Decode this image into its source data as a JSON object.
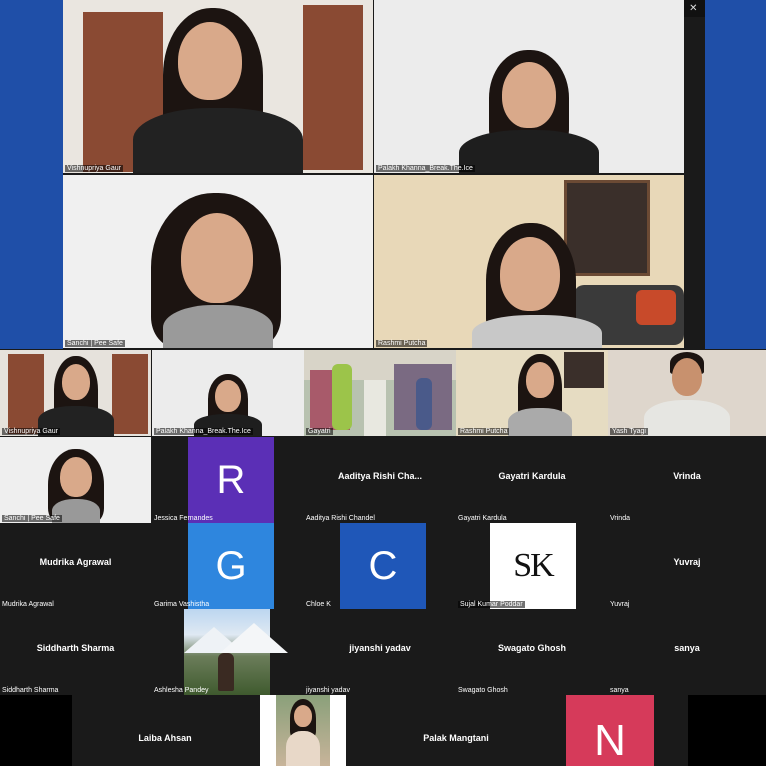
{
  "window": {
    "controls": [
      "–",
      "❐",
      "✕"
    ]
  },
  "speaker_view": [
    {
      "name": "Vishnupriya Gaur"
    },
    {
      "name": "Palakh Khanna_Break.The.Ice"
    },
    {
      "name": "Sanchi | Pee Safe"
    },
    {
      "name": "Rashmi Putcha"
    }
  ],
  "gallery": {
    "video_tiles": [
      {
        "label": "Vishnupriya Gaur"
      },
      {
        "label": "Palakh Khanna_Break.The.Ice"
      },
      {
        "label": "Gayatri"
      },
      {
        "label": "Rashmi Putcha"
      },
      {
        "label": "Yash Tyagi"
      },
      {
        "label": "Sanchi | Pee Safe"
      }
    ],
    "participants": {
      "jessica": {
        "label": "Jessica Fernandes",
        "avatar": "R",
        "color": "#5b2fb6"
      },
      "aaditya": {
        "name": "Aaditya Rishi Cha...",
        "label": "Aaditya Rishi Chandel"
      },
      "gayatri_k": {
        "name": "Gayatri Kardula",
        "label": "Gayatri Kardula"
      },
      "vrinda": {
        "name": "Vrinda",
        "label": "Vrinda"
      },
      "mudrika": {
        "name": "Mudrika Agrawal",
        "label": "Mudrika Agrawal"
      },
      "garima": {
        "label": "Garima Vashistha",
        "avatar": "G",
        "color": "#2e86de"
      },
      "chloe": {
        "label": "Chloe K",
        "avatar": "C",
        "color": "#1f57b8"
      },
      "sujal": {
        "label": "Sujal Kumar Poddar",
        "avatar": "SK"
      },
      "yuvraj": {
        "name": "Yuvraj",
        "label": "Yuvraj"
      },
      "siddharth": {
        "name": "Siddharth Sharma",
        "label": "Siddharth Sharma"
      },
      "ashlesha": {
        "label": "Ashlesha Pandey"
      },
      "jiyanshi": {
        "name": "jiyanshi yadav",
        "label": "jiyanshi yadav"
      },
      "swagato": {
        "name": "Swagato Ghosh",
        "label": "Swagato Ghosh"
      },
      "sanya": {
        "name": "sanya",
        "label": "sanya"
      },
      "laiba": {
        "name": "Laiba Ahsan"
      },
      "palak": {
        "name": "Palak Mangtani"
      },
      "last_avatar": {
        "avatar": "N",
        "color": "#d63a5a"
      }
    }
  }
}
